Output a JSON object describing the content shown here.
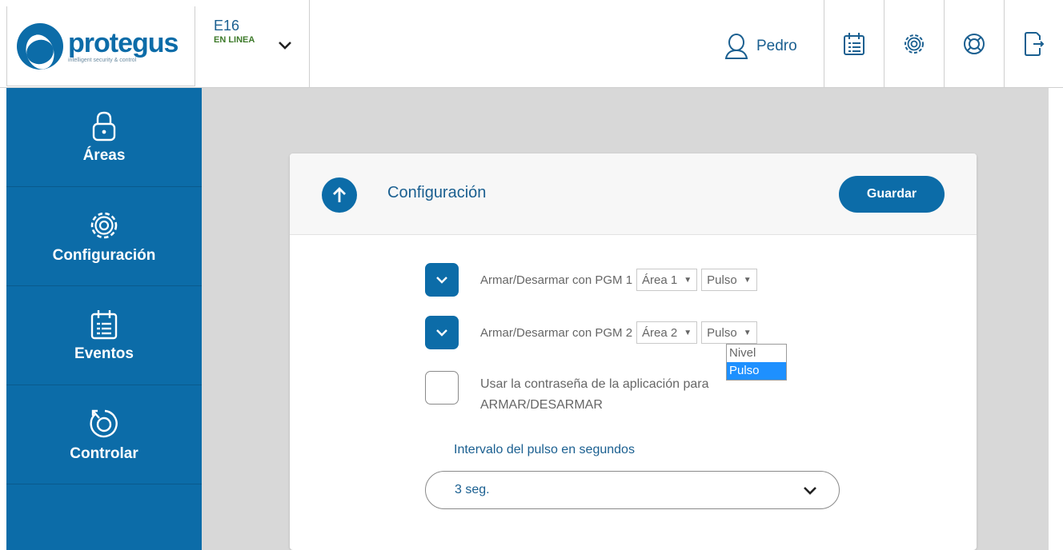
{
  "header": {
    "logo": {
      "name": "protegus",
      "tagline": "intelligent security & control"
    },
    "device": {
      "name": "E16",
      "status": "EN LINEA"
    },
    "user": {
      "name": "Pedro"
    },
    "icons": [
      "user-icon",
      "calendar-list-icon",
      "gear-icon",
      "lifebuoy-icon",
      "logout-icon"
    ]
  },
  "sidebar": {
    "items": [
      {
        "label": "Áreas",
        "icon": "lock-icon"
      },
      {
        "label": "Configuración",
        "icon": "gear-icon"
      },
      {
        "label": "Eventos",
        "icon": "calendar-list-icon"
      },
      {
        "label": "Controlar",
        "icon": "dial-icon"
      }
    ]
  },
  "card": {
    "title": "Configuración",
    "save_label": "Guardar",
    "rows": [
      {
        "label": "Armar/Desarmar con PGM 1",
        "area": "Área 1",
        "mode": "Pulso",
        "checked": true
      },
      {
        "label": "Armar/Desarmar con PGM 2",
        "area": "Área 2",
        "mode": "Pulso",
        "checked": true
      }
    ],
    "mode_dropdown": {
      "options": [
        "Nivel",
        "Pulso"
      ],
      "selected": "Pulso"
    },
    "password_option": {
      "label": "Usar la contraseña de la aplicación para ARMAR/DESARMAR",
      "checked": false
    },
    "interval": {
      "label": "Intervalo del pulso en segundos",
      "value": "3 seg."
    }
  },
  "colors": {
    "brand": "#0c6ca8",
    "text_blue": "#1a5f90",
    "status_green": "#3d7a2a",
    "highlight": "#1e90ff"
  }
}
